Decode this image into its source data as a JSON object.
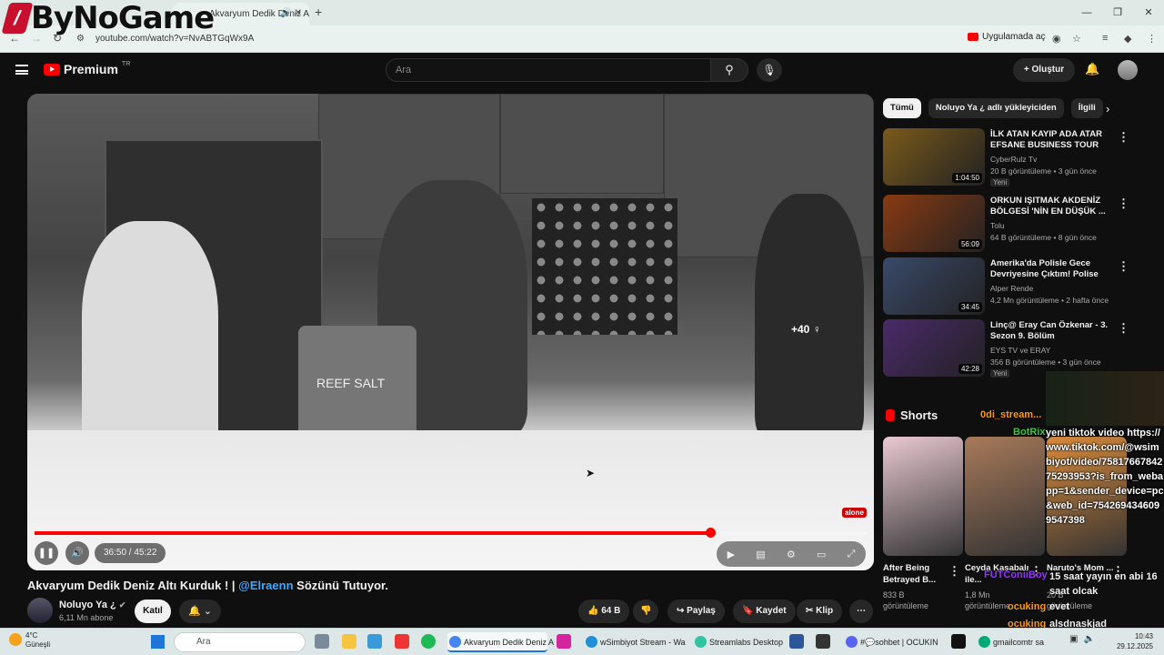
{
  "watermark": {
    "text": "ByNoGame"
  },
  "browser": {
    "tab_title": "Akvaryum Dedik Deniz Altı",
    "url": "youtube.com/watch?v=NvABTGqWx9A",
    "open_in_app": "Uygulamada aç"
  },
  "header": {
    "logo_text": "Premium",
    "logo_region": "TR",
    "search_placeholder": "Ara",
    "create_label": "Oluştur"
  },
  "player": {
    "time": "36:50 / 45:22",
    "progress": 0.812,
    "overlay_text": "+40 ♀",
    "bucket_label": "REEF SALT",
    "side_badge": "alone"
  },
  "video": {
    "title_pre": "Akvaryum Dedik Deniz Altı Kurduk ! | ",
    "title_mention": "@Elraenn",
    "title_post": " Sözünü Tutuyor.",
    "channel": "Noluyo Ya ¿",
    "subs": "6,11 Mn abone",
    "join": "Katıl",
    "likes": "64 B",
    "share": "Paylaş",
    "save": "Kaydet",
    "clip": "Klip"
  },
  "sidebar": {
    "chips": [
      "Tümü",
      "Noluyo Ya ¿ adlı yükleyiciden",
      "İlgili"
    ],
    "recs": [
      {
        "title": "İLK ATAN KAYIP ADA ATAR EFSANE BUSINESS TOUR",
        "channel": "CyberRulz Tv",
        "meta": "20 B görüntüleme • 3 gün önce",
        "badge": "Yeni",
        "duration": "1:04:50",
        "color": "#7a5a1a"
      },
      {
        "title": "ORKUN IŞITMAK AKDENİZ BÖLGESİ 'NİN EN DÜŞÜK ...",
        "channel": "Tolu",
        "meta": "64 B görüntüleme • 8 gün önce",
        "badge": "",
        "duration": "56:09",
        "color": "#8a3a12"
      },
      {
        "title": "Amerika'da Polisle Gece Devriyesine Çıktım! Polise Küf...",
        "channel": "Alper Rende",
        "meta": "4,2 Mn görüntüleme • 2 hafta önce",
        "badge": "",
        "duration": "34:45",
        "color": "#3a4a6a"
      },
      {
        "title": "Linç@ Eray Can Özkenar - 3. Sezon 9. Bölüm",
        "channel": "EYS TV ve ERAY",
        "meta": "356 B görüntüleme • 3 gün önce",
        "badge": "Yeni",
        "duration": "42:28",
        "color": "#4a2a6a"
      }
    ],
    "shorts_title": "Shorts",
    "shorts": [
      {
        "title": "After Being Betrayed B...",
        "views": "833 B",
        "views2": "görüntüleme",
        "color": "#e9c9d2"
      },
      {
        "title": "Ceyda Kasabalı ile...",
        "views": "1,8 Mn",
        "views2": "görüntüleme",
        "color": "#a87a5a"
      },
      {
        "title": "Naruto's Mom ...",
        "views": "20 B",
        "views2": "görüntüleme",
        "color": "#d98a3a"
      }
    ]
  },
  "chat": {
    "user_top": "0di_stream...",
    "bot": "BotRix",
    "message": "yeni tiktok video https://www.tiktok.com/@wsimbiyot/video/7581766784275293953?is_from_webapp=1&sender_device=pc&web_id=7542694346099547398",
    "user_mid": "FUTConiiBoy",
    "msg2": "15 saat yayın en abi 16 saat olcak",
    "user_ocuk1": "ocuking",
    "msg3": "evet",
    "user_ocuk2": "ocuking",
    "msg4": "alsdnaskjad"
  },
  "taskbar": {
    "temp": "4°C",
    "weather": "Güneşli",
    "search": "Ara",
    "apps": [
      "Akvaryum Dedik Deniz A",
      "wSimbiyot Stream - Wa",
      "Streamlabs Desktop",
      "#💬sohbet | OCUKIN",
      "gmailcomtr sa"
    ],
    "time": "10:43",
    "date": "29.12.2025"
  },
  "colors": {
    "accent": "#ff0000",
    "mention": "#3ea6ff"
  }
}
